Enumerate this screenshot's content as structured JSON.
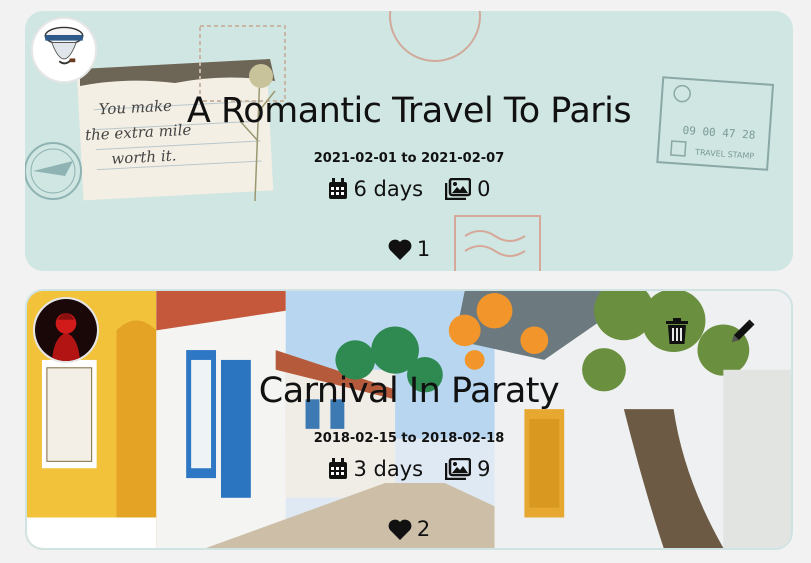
{
  "trips": [
    {
      "title": "A Romantic Travel To Paris",
      "start_date": "2021-02-01",
      "to_word": "to",
      "end_date": "2021-02-07",
      "duration": "6 days",
      "photo_count": "0",
      "likes": "1",
      "cover_theme": "vintage-postcard",
      "bg_color": "#cfe6e2",
      "avatar": "sailor-avatar",
      "postcard_text": [
        "You make",
        "the extra mile",
        "worth it."
      ],
      "stamp_text": [
        "09 00 47 28",
        "TRAVEL STAMP"
      ]
    },
    {
      "title": "Carnival In Paraty",
      "start_date": "2018-02-15",
      "to_word": "to",
      "end_date": "2018-02-18",
      "duration": "3 days",
      "photo_count": "9",
      "likes": "2",
      "cover_theme": "colonial-street",
      "avatar": "red-silhouette-avatar",
      "actions": [
        "delete",
        "edit"
      ]
    }
  ],
  "icons": {
    "calendar": "calendar-icon",
    "photos": "photos-icon",
    "heart": "heart-icon",
    "trash": "trash-icon",
    "pencil": "pencil-icon"
  }
}
